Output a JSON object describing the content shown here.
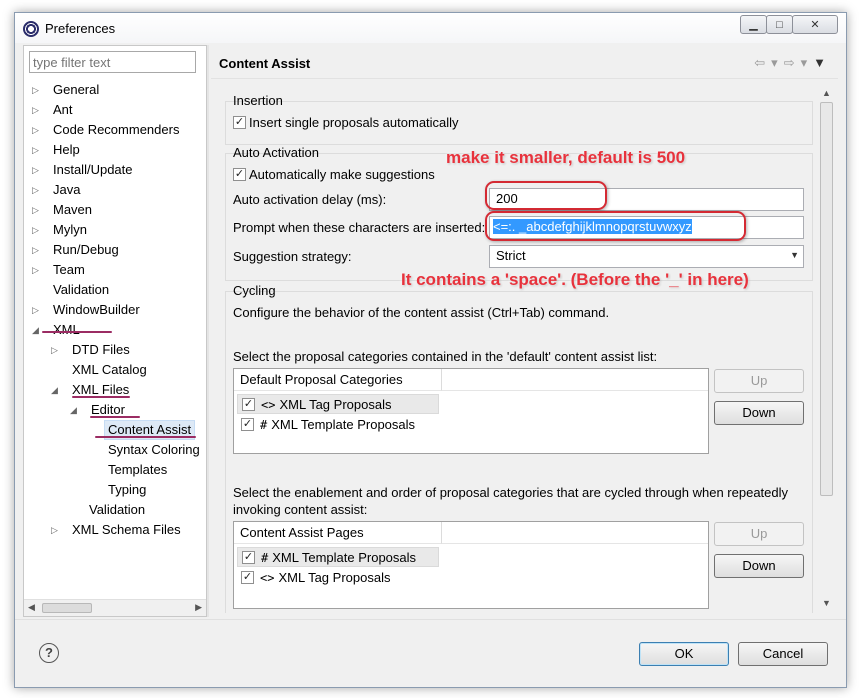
{
  "window": {
    "title": "Preferences",
    "buttons": {
      "minimize": "▁",
      "maximize": "□",
      "close": "✕"
    }
  },
  "nav": {
    "filter_placeholder": "type filter text",
    "items": [
      {
        "label": "General",
        "twisty": "▷"
      },
      {
        "label": "Ant",
        "twisty": "▷"
      },
      {
        "label": "Code Recommenders",
        "twisty": "▷"
      },
      {
        "label": "Help",
        "twisty": "▷"
      },
      {
        "label": "Install/Update",
        "twisty": "▷"
      },
      {
        "label": "Java",
        "twisty": "▷"
      },
      {
        "label": "Maven",
        "twisty": "▷"
      },
      {
        "label": "Mylyn",
        "twisty": "▷"
      },
      {
        "label": "Run/Debug",
        "twisty": "▷"
      },
      {
        "label": "Team",
        "twisty": "▷"
      },
      {
        "label": "Validation",
        "twisty": ""
      },
      {
        "label": "WindowBuilder",
        "twisty": "▷"
      },
      {
        "label": "XML",
        "twisty": "◢"
      },
      {
        "label": "DTD Files",
        "twisty": "▷"
      },
      {
        "label": "XML Catalog",
        "twisty": ""
      },
      {
        "label": "XML Files",
        "twisty": "◢"
      },
      {
        "label": "Editor",
        "twisty": "◢"
      },
      {
        "label": "Content Assist",
        "twisty": ""
      },
      {
        "label": "Syntax Coloring",
        "twisty": ""
      },
      {
        "label": "Templates",
        "twisty": ""
      },
      {
        "label": "Typing",
        "twisty": ""
      },
      {
        "label": "Validation",
        "twisty": ""
      },
      {
        "label": "XML Schema Files",
        "twisty": "▷"
      }
    ],
    "selected": "Content Assist"
  },
  "page": {
    "title": "Content Assist",
    "history": {
      "back": "⇦",
      "forward": "⇨",
      "dropdown": "▾",
      "menu": "▼"
    }
  },
  "insertion": {
    "title": "Insertion",
    "insert_single": {
      "label": "Insert single proposals automatically",
      "checked": true
    }
  },
  "auto_activation": {
    "title": "Auto Activation",
    "make_suggestions": {
      "label": "Automatically make suggestions",
      "checked": true
    },
    "delay_label": "Auto activation delay (ms):",
    "delay_value": "200",
    "prompt_label": "Prompt when these characters are inserted:",
    "prompt_value": "<=:. _abcdefghijklmnopqrstuvwxyz",
    "strategy_label": "Suggestion strategy:",
    "strategy_value": "Strict"
  },
  "cycling": {
    "title": "Cycling",
    "description": "Configure the behavior of the content assist (Ctrl+Tab) command.",
    "default_list_label": "Select the proposal categories contained in the 'default' content assist list:",
    "default_table": {
      "header": "Default Proposal Categories",
      "rows": [
        {
          "icon": "<>",
          "label": "XML Tag Proposals",
          "checked": true
        },
        {
          "icon": "#",
          "label": "XML Template Proposals",
          "checked": true
        }
      ]
    },
    "cycle_label_1": "Select the enablement and order of proposal categories that are cycled through when repeatedly",
    "cycle_label_2": "invoking content assist:",
    "pages_table": {
      "header": "Content Assist Pages",
      "rows": [
        {
          "icon": "#",
          "label": "XML Template Proposals",
          "checked": true
        },
        {
          "icon": "<>",
          "label": "XML Tag Proposals",
          "checked": true
        }
      ]
    },
    "up_label": "Up",
    "down_label": "Down"
  },
  "footer": {
    "help": "?",
    "ok": "OK",
    "cancel": "Cancel"
  },
  "annotations": {
    "delay_note": "make it smaller, default is 500",
    "space_note": "It contains a 'space'. (Before the '_' in here)",
    "color": "#e8323c"
  }
}
